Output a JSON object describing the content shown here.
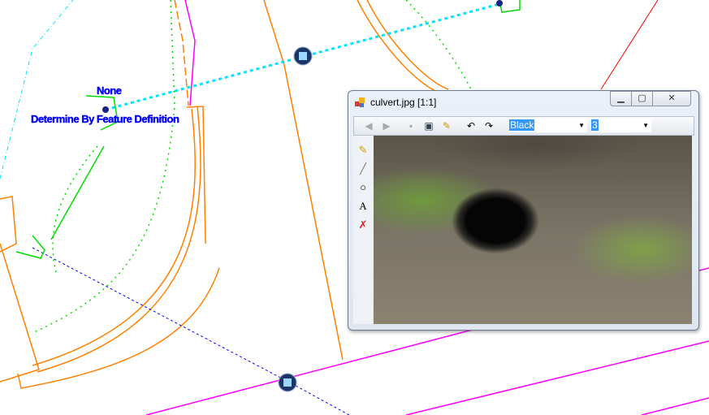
{
  "labels": {
    "none": "None",
    "determine": "Determine By Feature Definition"
  },
  "viewer": {
    "title": "culvert.jpg [1:1]",
    "window_buttons": {
      "minimize": "minimize-icon",
      "maximize": "maximize-icon",
      "close": "close-icon"
    },
    "toolbar": {
      "color_value": "Black",
      "width_value": "3"
    },
    "side_tools": [
      "pencil-icon",
      "line-icon",
      "circle-icon",
      "text-icon",
      "eraser-icon"
    ],
    "text_tool_glyph": "A"
  },
  "colors": {
    "road": "#ff8000",
    "boundary": "#ff00ff",
    "link": "#00e5ff",
    "green": "#00dd00",
    "label": "#0000ff"
  }
}
